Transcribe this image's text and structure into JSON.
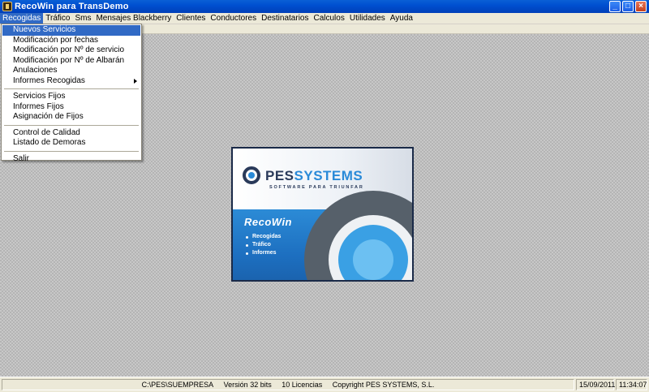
{
  "window": {
    "title": "RecoWin para TransDemo",
    "controls": [
      "minimize",
      "maximize",
      "close"
    ]
  },
  "menubar": {
    "items": [
      "Recogidas",
      "Tráfico",
      "Sms",
      "Mensajes Blackberry",
      "Clientes",
      "Conductores",
      "Destinatarios",
      "Calculos",
      "Utilidades",
      "Ayuda"
    ],
    "active": "Recogidas"
  },
  "dropdown": {
    "items": [
      {
        "label": "Nuevos Servicios",
        "selected": true
      },
      {
        "label": "Modificación por fechas"
      },
      {
        "label": "Modificación por Nº de servicio"
      },
      {
        "label": "Modificación por Nº de Albarán"
      },
      {
        "label": "Anulaciones"
      },
      {
        "label": "Informes Recogidas",
        "submenu": true
      },
      {
        "separator": true
      },
      {
        "label": "Servicios Fijos"
      },
      {
        "label": "Informes Fijos"
      },
      {
        "label": "Asignación de Fijos"
      },
      {
        "separator": true
      },
      {
        "label": "Control de Calidad"
      },
      {
        "label": "Listado de Demoras"
      },
      {
        "separator": true
      },
      {
        "label": "Salir"
      }
    ]
  },
  "splash": {
    "brand_a": "PES",
    "brand_b": "SYSTEMS",
    "tagline": "SOFTWARE PARA TRIUNFAR",
    "product": "RecoWin",
    "features": [
      "Recogidas",
      "Tráfico",
      "Informes"
    ]
  },
  "statusbar": {
    "path": "C:\\PES\\SUEMPRESA",
    "version": "Versión 32 bits",
    "licenses": "10 Licencias",
    "copyright": "Copyright PES SYSTEMS, S.L.",
    "date": "15/09/2011",
    "time": "11:34:07"
  },
  "colors": {
    "titlebar": "#0050d0",
    "selection": "#316ac5",
    "splash_blue": "#1d6fc0"
  }
}
